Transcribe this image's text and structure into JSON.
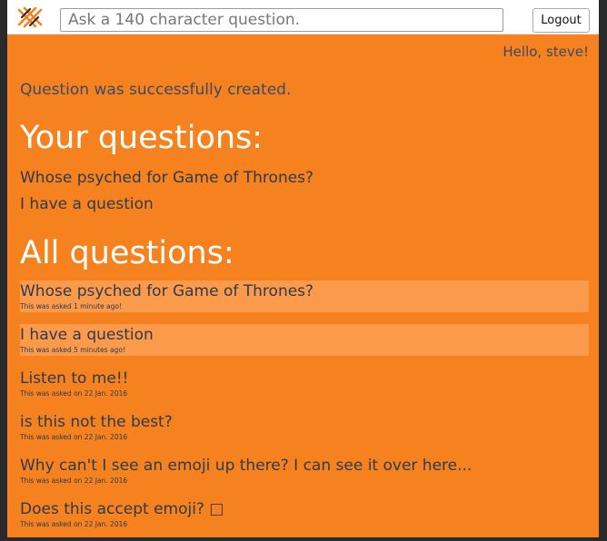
{
  "header": {
    "search_placeholder": "Ask a 140 character question.",
    "logout_label": "Logout"
  },
  "greeting": "Hello, steve!",
  "flash": "Question was successfully created.",
  "your_questions": {
    "heading": "Your questions:",
    "items": [
      "Whose psyched for Game of Thrones?",
      "I have a question"
    ]
  },
  "all_questions": {
    "heading": "All questions:",
    "items": [
      {
        "title": "Whose psyched for Game of Thrones?",
        "meta": "This was asked 1 minute ago!",
        "highlighted": true
      },
      {
        "title": "I have a question",
        "meta": "This was asked 5 minutes ago!",
        "highlighted": true
      },
      {
        "title": "Listen to me!!",
        "meta": "This was asked on 22 Jan. 2016",
        "highlighted": false
      },
      {
        "title": "is this not the best?",
        "meta": "This was asked on 22 Jan. 2016",
        "highlighted": false
      },
      {
        "title": "Why can't I see an emoji up there? I can see it over here...",
        "meta": "This was asked on 22 Jan. 2016",
        "highlighted": false
      },
      {
        "title": "Does this accept emoji? □",
        "meta": "This was asked on 22 Jan. 2016",
        "highlighted": false
      }
    ]
  },
  "colors": {
    "background": "#f5821f",
    "highlight": "#fb9a4b",
    "text_dark": "#2e3a4e",
    "heading": "#ffffff"
  }
}
